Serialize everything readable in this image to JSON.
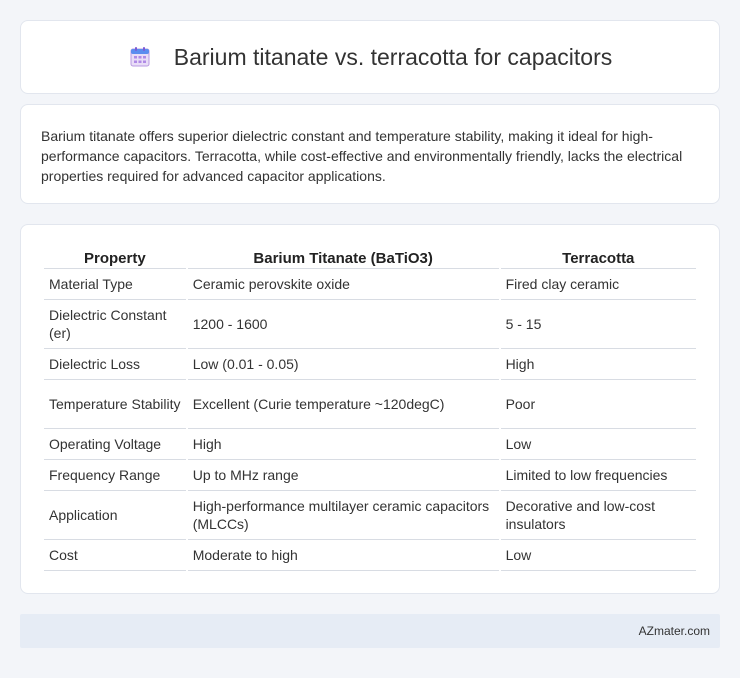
{
  "header": {
    "icon": "calendar-icon",
    "title": "Barium titanate vs. terracotta for capacitors"
  },
  "intro": {
    "text": "Barium titanate offers superior dielectric constant and temperature stability, making it ideal for high-performance capacitors. Terracotta, while cost-effective and environmentally friendly, lacks the electrical properties required for advanced capacitor applications."
  },
  "table": {
    "headers": [
      "Property",
      "Barium Titanate (BaTiO3)",
      "Terracotta"
    ],
    "rows": [
      [
        "Material Type",
        "Ceramic perovskite oxide",
        "Fired clay ceramic"
      ],
      [
        "Dielectric Constant (er)",
        "1200 - 1600",
        "5 - 15"
      ],
      [
        "Dielectric Loss",
        "Low (0.01 - 0.05)",
        "High"
      ],
      [
        "Temperature Stability",
        "Excellent (Curie temperature ~120degC)",
        "Poor"
      ],
      [
        "Operating Voltage",
        "High",
        "Low"
      ],
      [
        "Frequency Range",
        "Up to MHz range",
        "Limited to low frequencies"
      ],
      [
        "Application",
        "High-performance multilayer ceramic capacitors (MLCCs)",
        "Decorative and low-cost insulators"
      ],
      [
        "Cost",
        "Moderate to high",
        "Low"
      ]
    ]
  },
  "footer": {
    "site": "AZmater.com"
  }
}
